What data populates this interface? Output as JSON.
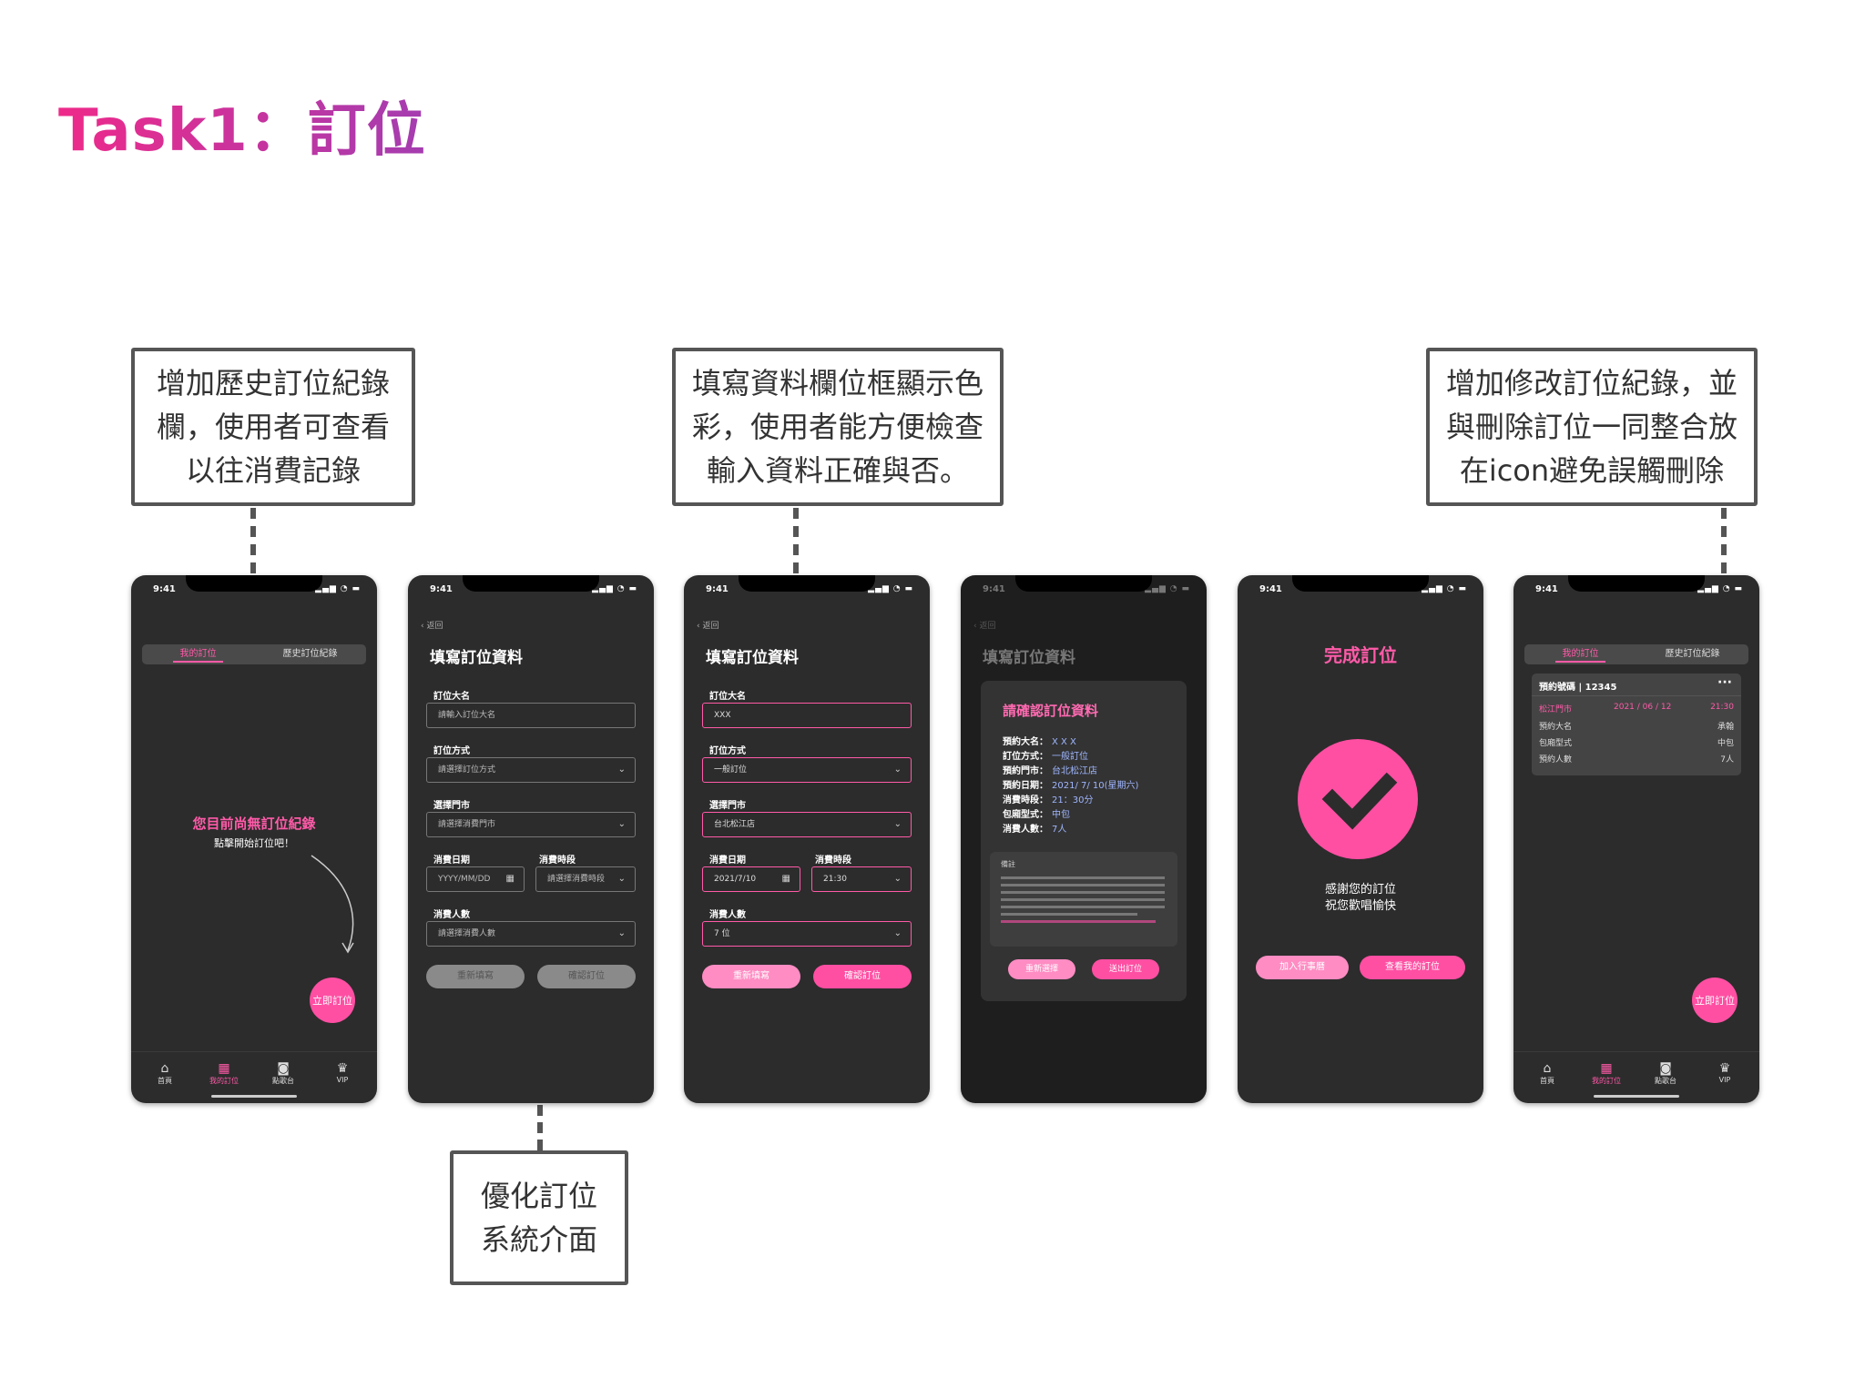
{
  "page_title": "Task1：訂位",
  "callouts": {
    "history": "增加歷史訂位紀錄欄，使用者可查看以往消費記錄",
    "color": "填寫資料欄位框顯示色彩，使用者能方便檢查輸入資料正確與否。",
    "edit": "增加修改訂位紀錄，並與刪除訂位一同整合放在icon避免誤觸刪除",
    "optimize": "優化訂位系統介面"
  },
  "status": {
    "time": "9:41",
    "icons": "▂▄▆ ◔ ▬"
  },
  "tabs": {
    "home": "首頁",
    "my_booking": "我的訂位",
    "ktv": "點歌台",
    "vip": "VIP"
  },
  "segment": {
    "mine": "我的訂位",
    "history": "歷史訂位紀錄"
  },
  "screen1": {
    "empty_title": "您目前尚無訂位紀錄",
    "empty_sub": "點擊開始訂位吧！",
    "fab": "立即訂位"
  },
  "form": {
    "back": "‹ 返回",
    "title": "填寫訂位資料",
    "name_label": "訂位大名",
    "method_label": "訂位方式",
    "store_label": "選擇門市",
    "date_label": "消費日期",
    "slot_label": "消費時段",
    "people_label": "消費人數",
    "reset": "重新填寫",
    "confirm": "確認訂位"
  },
  "screen2": {
    "name_ph": "請輸入訂位大名",
    "method_ph": "請選擇訂位方式",
    "store_ph": "請選擇消費門市",
    "date_ph": "YYYY/MM/DD",
    "slot_ph": "請選擇消費時段",
    "people_ph": "請選擇消費人數"
  },
  "screen3": {
    "name": "XXX",
    "method": "一般訂位",
    "store": "台北松江店",
    "date": "2021/7/10",
    "slot": "21:30",
    "people": "7 位"
  },
  "screen4": {
    "modal_title": "請確認訂位資料",
    "rows": [
      {
        "k": "預約大名：",
        "v": "X X X"
      },
      {
        "k": "訂位方式：",
        "v": "一般訂位"
      },
      {
        "k": "預約門市：",
        "v": "台北松江店"
      },
      {
        "k": "預約日期：",
        "v": "2021/ 7/ 10(星期六)"
      },
      {
        "k": "消費時段：",
        "v": "21：30分"
      },
      {
        "k": "包廂型式：",
        "v": "中包"
      },
      {
        "k": "消費人數：",
        "v": "7人"
      }
    ],
    "note_title": "備註",
    "reselect": "重新選擇",
    "submit": "送出訂位"
  },
  "screen5": {
    "title": "完成訂位",
    "thanks1": "感謝您的訂位",
    "thanks2": "祝您歡唱愉快",
    "add_calendar": "加入行事曆",
    "view": "查看我的訂位"
  },
  "screen6": {
    "booking_no": "預約號碼 | 12345",
    "more": "···",
    "store": "松江門市",
    "date": "2021 / 06 / 12",
    "time": "21:30",
    "rows": [
      {
        "k": "預約大名",
        "v": "承翰"
      },
      {
        "k": "包廂型式",
        "v": "中包"
      },
      {
        "k": "預約人數",
        "v": "7人"
      }
    ],
    "fab": "立即訂位"
  },
  "colors": {
    "accent": "#ff4fa3",
    "title_start": "#ee2a8a",
    "title_end": "#a43db0"
  },
  "icons": [
    "home-icon",
    "calendar-icon",
    "mic-icon",
    "crown-icon",
    "check-icon",
    "chevron-down-icon",
    "calendar-small-icon"
  ]
}
